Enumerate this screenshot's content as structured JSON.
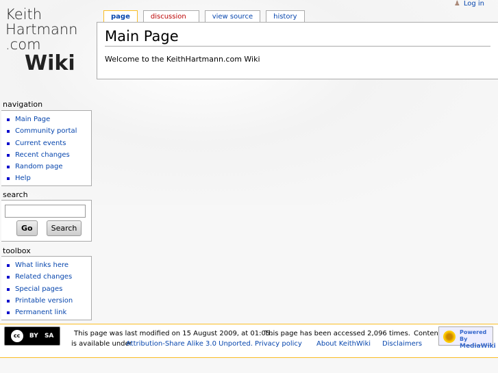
{
  "logo": {
    "line1": "Keith",
    "line2": "Hartmann",
    "line3": ".com",
    "line4": "Wiki"
  },
  "user": {
    "login": "Log in"
  },
  "tabs": [
    {
      "label": "page"
    },
    {
      "label": "discussion"
    },
    {
      "label": "view source"
    },
    {
      "label": "history"
    }
  ],
  "content": {
    "title": "Main Page",
    "body": "Welcome to the KeithHartmann.com Wiki"
  },
  "navigation": {
    "heading": "navigation",
    "items": [
      "Main Page",
      "Community portal",
      "Current events",
      "Recent changes",
      "Random page",
      "Help"
    ]
  },
  "search": {
    "heading": "search",
    "value": "",
    "go": "Go",
    "search": "Search"
  },
  "toolbox": {
    "heading": "toolbox",
    "items": [
      "What links here",
      "Related changes",
      "Special pages",
      "Printable version",
      "Permanent link"
    ]
  },
  "footer": {
    "cc_by": "BY",
    "cc_sa": "SA",
    "modified": "This page was last modified on 15 August 2009, at 01:05.",
    "accessed": "This page has been accessed 2,096 times.",
    "content_prefix": "Content",
    "available": "is available under",
    "license": "Attribution-Share Alike 3.0 Unported.",
    "privacy": "Privacy policy",
    "about": "About KeithWiki",
    "disclaimers": "Disclaimers",
    "powered_by": "Powered By",
    "mediawiki": "MediaWiki"
  }
}
